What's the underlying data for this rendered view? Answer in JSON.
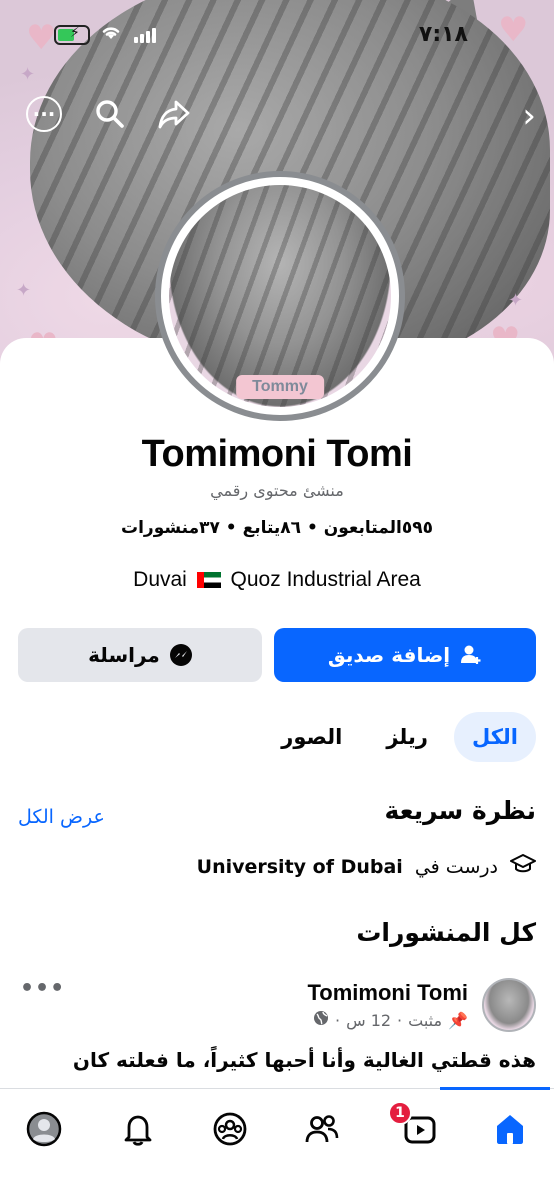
{
  "status_bar": {
    "time": "٧:١٨"
  },
  "profile": {
    "name": "Tomimoni Tomi",
    "subtitle": "منشئ محتوى رقمي",
    "stats": "٥٩٥المتابعون • ٨٦يتابع • ٣٧منشورات",
    "location_city": "Duvai",
    "location_area": "Quoz Industrial Area",
    "avatar_tag": "Tommy"
  },
  "actions": {
    "add_friend_label": "إضافة صديق",
    "message_label": "مراسلة"
  },
  "tabs": [
    {
      "label": "الكل",
      "active": true
    },
    {
      "label": "ريلز",
      "active": false
    },
    {
      "label": "الصور",
      "active": false
    }
  ],
  "overview": {
    "title": "نظرة سريعة",
    "see_all": "عرض الكل",
    "education_prefix": "درست في",
    "education_school": "University of Dubai"
  },
  "posts": {
    "title": "كل المنشورات",
    "items": [
      {
        "author": "Tomimoni Tomi",
        "pinned_label": "مثبت",
        "time": "12 س",
        "separator": "·",
        "text": "هذه قطتي الغالية وأنا أحبها كثيراً، ما فعلته كان"
      }
    ]
  },
  "bottom_nav": {
    "items": [
      {
        "name": "home",
        "active": true
      },
      {
        "name": "video",
        "badge": "1"
      },
      {
        "name": "friends"
      },
      {
        "name": "groups"
      },
      {
        "name": "notifications"
      },
      {
        "name": "profile"
      }
    ]
  },
  "colors": {
    "accent": "#0866ff",
    "badge": "#e41e3f",
    "secondary_button": "#e4e6eb"
  }
}
